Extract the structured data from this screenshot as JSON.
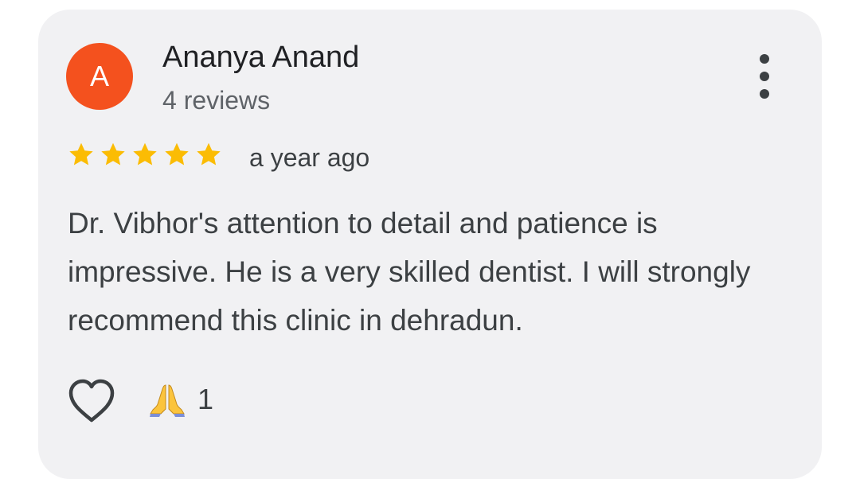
{
  "review": {
    "avatar_letter": "A",
    "author_name": "Ananya Anand",
    "review_count": "4 reviews",
    "rating": 5,
    "rating_max": 5,
    "time_ago": "a year ago",
    "text": "Dr. Vibhor's attention to detail and patience is impressive. He is a very skilled dentist. I will strongly recommend this clinic in dehradun.",
    "reaction_count": "1"
  },
  "icons": {
    "menu": "more-vert-icon",
    "like": "heart-outline-icon",
    "reaction": "folded-hands-emoji",
    "star": "star-icon"
  },
  "colors": {
    "avatar_bg": "#f4511e",
    "star": "#fbbc04",
    "card_bg": "#f1f1f3"
  }
}
